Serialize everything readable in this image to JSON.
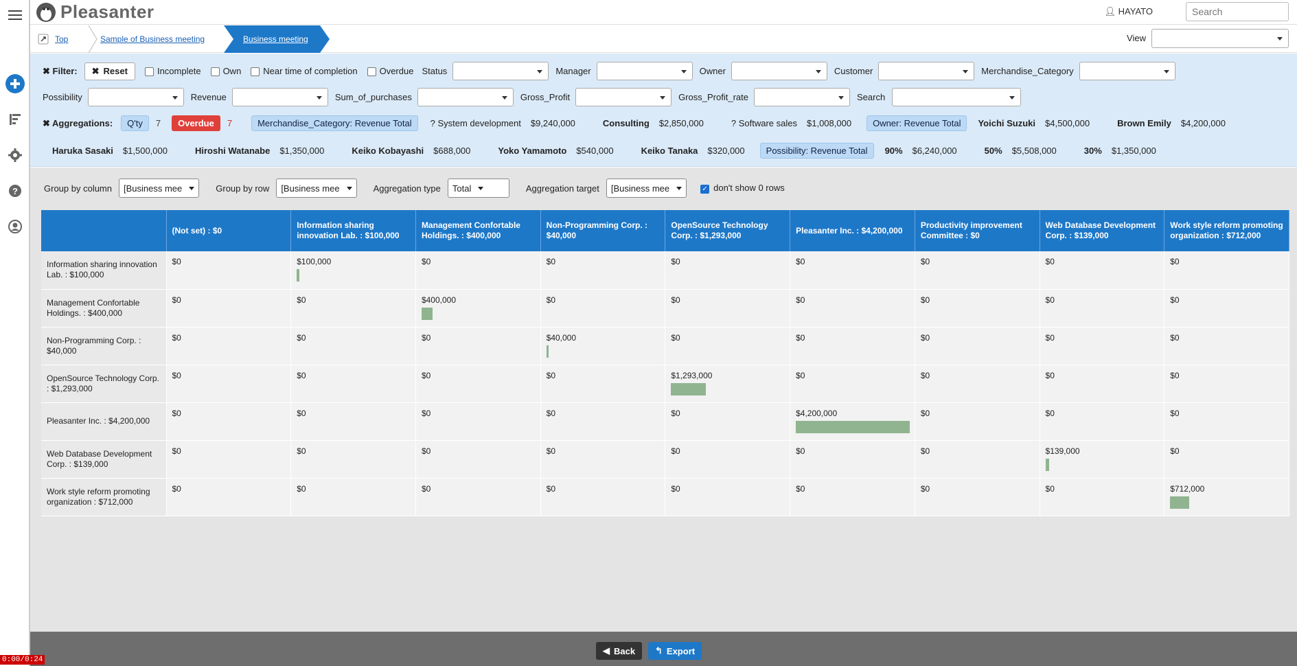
{
  "app": {
    "title": "Pleasanter"
  },
  "header": {
    "user": "HAYATO",
    "search_placeholder": "Search"
  },
  "breadcrumb": {
    "items": [
      "Top",
      "Sample of Business meeting",
      "Business meeting"
    ]
  },
  "view": {
    "label": "View",
    "value": ""
  },
  "filters": {
    "title": "Filter:",
    "reset": "Reset",
    "checkboxes": [
      "Incomplete",
      "Own",
      "Near time of completion",
      "Overdue"
    ],
    "row1_selects": [
      "Status",
      "Manager",
      "Owner",
      "Customer",
      "Merchandise_Category"
    ],
    "row2_selects": [
      "Possibility",
      "Revenue",
      "Sum_of_purchases",
      "Gross_Profit",
      "Gross_Profit_rate"
    ],
    "search_label": "Search"
  },
  "aggregations": {
    "title": "Aggregations:",
    "qty_label": "Q'ty",
    "qty_count": "7",
    "overdue_label": "Overdue",
    "overdue_count": "7",
    "merch_label": "Merchandise_Category: Revenue Total",
    "merch_items": [
      {
        "name": "? System development",
        "value": "$9,240,000"
      },
      {
        "name": "Consulting",
        "value": "$2,850,000"
      },
      {
        "name": "? Software sales",
        "value": "$1,008,000"
      }
    ],
    "owner_label": "Owner: Revenue Total",
    "owner_items": [
      {
        "name": "Yoichi Suzuki",
        "value": "$4,500,000"
      },
      {
        "name": "Brown Emily",
        "value": "$4,200,000"
      },
      {
        "name": "Haruka Sasaki",
        "value": "$1,500,000"
      },
      {
        "name": "Hiroshi Watanabe",
        "value": "$1,350,000"
      },
      {
        "name": "Keiko Kobayashi",
        "value": "$688,000"
      },
      {
        "name": "Yoko Yamamoto",
        "value": "$540,000"
      },
      {
        "name": "Keiko Tanaka",
        "value": "$320,000"
      }
    ],
    "poss_label": "Possibility: Revenue Total",
    "poss_items": [
      {
        "name": "90%",
        "value": "$6,240,000"
      },
      {
        "name": "50%",
        "value": "$5,508,000"
      },
      {
        "name": "30%",
        "value": "$1,350,000"
      }
    ]
  },
  "grouping": {
    "group_by_column_label": "Group by column",
    "group_by_column_value": "[Business mee",
    "group_by_row_label": "Group by row",
    "group_by_row_value": "[Business mee",
    "agg_type_label": "Aggregation type",
    "agg_type_value": "Total",
    "agg_target_label": "Aggregation target",
    "agg_target_value": "[Business mee",
    "hide_zero_label": "don't show 0 rows"
  },
  "table": {
    "columns": [
      "(Not set) : $0",
      "Information sharing innovation Lab. : $100,000",
      "Management Confortable Holdings. : $400,000",
      "Non-Programming Corp. : $40,000",
      "OpenSource Technology Corp. : $1,293,000",
      "Pleasanter Inc. : $4,200,000",
      "Productivity improvement Committee : $0",
      "Web Database Development Corp. : $139,000",
      "Work style reform promoting organization : $712,000"
    ],
    "rows": [
      {
        "label": "Information sharing innovation Lab. : $100,000",
        "cells": [
          "$0",
          "$100,000",
          "$0",
          "$0",
          "$0",
          "$0",
          "$0",
          "$0",
          "$0"
        ],
        "bar_col": 1,
        "bar_value": 100000
      },
      {
        "label": "Management Confortable Holdings. : $400,000",
        "cells": [
          "$0",
          "$0",
          "$400,000",
          "$0",
          "$0",
          "$0",
          "$0",
          "$0",
          "$0"
        ],
        "bar_col": 2,
        "bar_value": 400000
      },
      {
        "label": "Non-Programming Corp. : $40,000",
        "cells": [
          "$0",
          "$0",
          "$0",
          "$40,000",
          "$0",
          "$0",
          "$0",
          "$0",
          "$0"
        ],
        "bar_col": 3,
        "bar_value": 40000
      },
      {
        "label": "OpenSource Technology Corp. : $1,293,000",
        "cells": [
          "$0",
          "$0",
          "$0",
          "$0",
          "$1,293,000",
          "$0",
          "$0",
          "$0",
          "$0"
        ],
        "bar_col": 4,
        "bar_value": 1293000
      },
      {
        "label": "Pleasanter Inc. : $4,200,000",
        "cells": [
          "$0",
          "$0",
          "$0",
          "$0",
          "$0",
          "$4,200,000",
          "$0",
          "$0",
          "$0"
        ],
        "bar_col": 5,
        "bar_value": 4200000
      },
      {
        "label": "Web Database Development Corp. : $139,000",
        "cells": [
          "$0",
          "$0",
          "$0",
          "$0",
          "$0",
          "$0",
          "$0",
          "$139,000",
          "$0"
        ],
        "bar_col": 7,
        "bar_value": 139000
      },
      {
        "label": "Work style reform promoting organization : $712,000",
        "cells": [
          "$0",
          "$0",
          "$0",
          "$0",
          "$0",
          "$0",
          "$0",
          "$0",
          "$712,000"
        ],
        "bar_col": 8,
        "bar_value": 712000
      }
    ]
  },
  "footer": {
    "back": "Back",
    "export": "Export"
  },
  "timer": "0:00/0:24",
  "colors": {
    "accent": "#1e78c8",
    "overdue": "#e0403a",
    "bar": "#90b490",
    "filter_bg": "#dbeaf8"
  }
}
